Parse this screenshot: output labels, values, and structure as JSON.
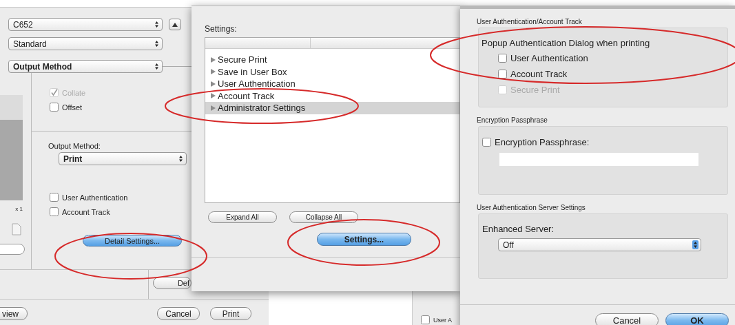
{
  "print_dialog": {
    "printer": "C652",
    "presets": "Standard",
    "panel": "Output Method",
    "copies_label": "x 1",
    "collate": {
      "label": "Collate",
      "checked": true,
      "disabled": true
    },
    "offset": {
      "label": "Offset",
      "checked": false,
      "disabled": false
    },
    "output_method_label": "Output Method:",
    "output_method": "Print",
    "user_authentication": {
      "label": "User Authentication",
      "checked": false,
      "disabled": false
    },
    "account_track": {
      "label": "Account Track",
      "checked": false,
      "disabled": false
    },
    "detail_settings_button": {
      "label": "Detail Settings...",
      "default": true
    },
    "partial_button": {
      "label": "Def",
      "default": false
    },
    "bottom_buttons": [
      {
        "label": "view",
        "default": false
      },
      {
        "label": "Cancel",
        "default": false
      },
      {
        "label": "Print",
        "default": false
      }
    ]
  },
  "detail_settings": {
    "settings_label": "Settings:",
    "items": [
      {
        "label": "Secure Print",
        "selected": false
      },
      {
        "label": "Save in User Box",
        "selected": false
      },
      {
        "label": "User Authentication",
        "selected": false
      },
      {
        "label": "Account Track",
        "selected": false
      },
      {
        "label": "Administrator Settings",
        "selected": true
      }
    ],
    "buttons": [
      {
        "label": "Expand All",
        "default": false
      },
      {
        "label": "Collapse All",
        "default": false
      }
    ],
    "settings_button": {
      "label": "Settings...",
      "default": true
    }
  },
  "background_window": {
    "checkbox": {
      "label": "User A",
      "checked": false,
      "disabled": false
    }
  },
  "administrator_settings": {
    "auth_group": {
      "title": "User Authentication/Account Track",
      "prompt": "Popup Authentication Dialog when printing",
      "options": [
        {
          "label": "User Authentication",
          "checked": false,
          "disabled": false
        },
        {
          "label": "Account Track",
          "checked": false,
          "disabled": false
        },
        {
          "label": "Secure Print",
          "checked": false,
          "disabled": true
        }
      ]
    },
    "encryption_group": {
      "title": "Encryption Passphrase",
      "checkbox": {
        "label": "Encryption Passphrase:",
        "checked": false,
        "disabled": false
      }
    },
    "server_group": {
      "title": "User Authentication Server Settings",
      "label": "Enhanced Server:",
      "value": "Off"
    },
    "buttons": [
      {
        "label": "Cancel",
        "default": false
      },
      {
        "label": "OK",
        "default": true
      }
    ]
  },
  "annotations": [
    {
      "kind": "ellipse"
    },
    {
      "kind": "ellipse"
    },
    {
      "kind": "ellipse"
    },
    {
      "kind": "ellipse"
    }
  ]
}
